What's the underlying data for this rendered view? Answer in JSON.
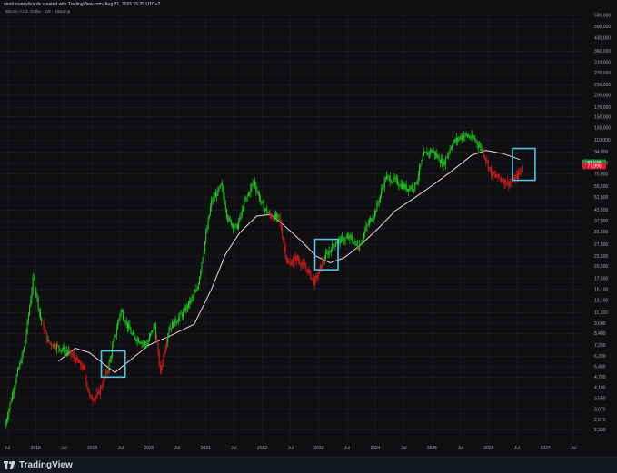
{
  "header": {
    "watermark": "stockmoneylizards created with TradingView.com, Aug 31, 2026 15:25 UTC+2",
    "symbol_line": "Bitcoin / U.S. Dollar · 1W · Bitstamp"
  },
  "footer": {
    "brand": "TradingView"
  },
  "colors": {
    "up": "#1fd31f",
    "down": "#e11b1b",
    "ma": "#f3d5de",
    "highlight_box": "#4fc3e8",
    "grid": "#1c2028",
    "axis_text": "#a3a6af",
    "price_tag_green": "#1f8f3a",
    "price_tag_red": "#d81e2e"
  },
  "chart_data": {
    "type": "candlestick",
    "scale": "log",
    "ylim": [
      2000,
      600000
    ],
    "y_ticks": [
      "580,000",
      "500,000",
      "430,000",
      "360,000",
      "310,000",
      "270,000",
      "230,000",
      "200,000",
      "170,000",
      "150,000",
      "130,000",
      "110,000",
      "94,000",
      "81,000",
      "70,000",
      "59,500",
      "51,500",
      "43,500",
      "37,500",
      "32,500",
      "27,500",
      "23,500",
      "20,500",
      "17,500",
      "15,100",
      "13,100",
      "11,100",
      "9,600",
      "8,400",
      "7,200",
      "6,200",
      "5,400",
      "4,700",
      "4,100",
      "3,550",
      "3,070",
      "2,670",
      "2,330"
    ],
    "x_ticks": [
      "Jul",
      "2018",
      "Jul",
      "2019",
      "Jul",
      "2020",
      "Jul",
      "2021",
      "Jul",
      "2022",
      "Jul",
      "2023",
      "Jul",
      "2024",
      "Jul",
      "2025",
      "Jul",
      "2026",
      "Jul",
      "2027",
      "Jul"
    ],
    "x_tick_dates": [
      2017.5,
      2018.0,
      2018.5,
      2019.0,
      2019.5,
      2020.0,
      2020.5,
      2021.0,
      2021.5,
      2022.0,
      2022.5,
      2023.0,
      2023.5,
      2024.0,
      2024.5,
      2025.0,
      2025.5,
      2026.0,
      2026.5,
      2027.0,
      2027.5
    ],
    "price_path": [
      {
        "date": 2017.45,
        "price": 2400
      },
      {
        "date": 2017.62,
        "price": 4200
      },
      {
        "date": 2017.8,
        "price": 7000
      },
      {
        "date": 2017.96,
        "price": 18000
      },
      {
        "date": 2018.08,
        "price": 10500
      },
      {
        "date": 2018.22,
        "price": 7500
      },
      {
        "date": 2018.4,
        "price": 7000
      },
      {
        "date": 2018.62,
        "price": 6400
      },
      {
        "date": 2018.85,
        "price": 5200
      },
      {
        "date": 2018.96,
        "price": 3500
      },
      {
        "date": 2019.1,
        "price": 3700
      },
      {
        "date": 2019.28,
        "price": 5300
      },
      {
        "date": 2019.5,
        "price": 11500
      },
      {
        "date": 2019.7,
        "price": 8200
      },
      {
        "date": 2019.96,
        "price": 7200
      },
      {
        "date": 2020.1,
        "price": 9500
      },
      {
        "date": 2020.2,
        "price": 5000
      },
      {
        "date": 2020.35,
        "price": 9000
      },
      {
        "date": 2020.6,
        "price": 11000
      },
      {
        "date": 2020.85,
        "price": 15000
      },
      {
        "date": 2021.0,
        "price": 30000
      },
      {
        "date": 2021.1,
        "price": 48000
      },
      {
        "date": 2021.28,
        "price": 60000
      },
      {
        "date": 2021.4,
        "price": 38000
      },
      {
        "date": 2021.55,
        "price": 34000
      },
      {
        "date": 2021.68,
        "price": 47000
      },
      {
        "date": 2021.85,
        "price": 64000
      },
      {
        "date": 2022.0,
        "price": 46000
      },
      {
        "date": 2022.15,
        "price": 40000
      },
      {
        "date": 2022.3,
        "price": 39000
      },
      {
        "date": 2022.45,
        "price": 21000
      },
      {
        "date": 2022.6,
        "price": 23000
      },
      {
        "date": 2022.8,
        "price": 19500
      },
      {
        "date": 2022.92,
        "price": 16500
      },
      {
        "date": 2023.1,
        "price": 23000
      },
      {
        "date": 2023.3,
        "price": 28500
      },
      {
        "date": 2023.55,
        "price": 30000
      },
      {
        "date": 2023.7,
        "price": 26500
      },
      {
        "date": 2023.85,
        "price": 35000
      },
      {
        "date": 2024.0,
        "price": 43000
      },
      {
        "date": 2024.18,
        "price": 67000
      },
      {
        "date": 2024.35,
        "price": 64000
      },
      {
        "date": 2024.55,
        "price": 58000
      },
      {
        "date": 2024.7,
        "price": 60000
      },
      {
        "date": 2024.85,
        "price": 90000
      },
      {
        "date": 2025.0,
        "price": 96000
      },
      {
        "date": 2025.2,
        "price": 80000
      },
      {
        "date": 2025.35,
        "price": 105000
      },
      {
        "date": 2025.55,
        "price": 118000
      },
      {
        "date": 2025.75,
        "price": 112000
      },
      {
        "date": 2025.9,
        "price": 95000
      },
      {
        "date": 2026.05,
        "price": 70000
      },
      {
        "date": 2026.2,
        "price": 66000
      },
      {
        "date": 2026.35,
        "price": 62000
      },
      {
        "date": 2026.5,
        "price": 68000
      },
      {
        "date": 2026.62,
        "price": 78000
      }
    ],
    "moving_average": [
      {
        "date": 2018.4,
        "price": 5800
      },
      {
        "date": 2018.7,
        "price": 6900
      },
      {
        "date": 2018.95,
        "price": 6500
      },
      {
        "date": 2019.2,
        "price": 5600
      },
      {
        "date": 2019.4,
        "price": 5000
      },
      {
        "date": 2019.7,
        "price": 6000
      },
      {
        "date": 2020.0,
        "price": 7200
      },
      {
        "date": 2020.4,
        "price": 8200
      },
      {
        "date": 2020.8,
        "price": 9500
      },
      {
        "date": 2021.1,
        "price": 15000
      },
      {
        "date": 2021.35,
        "price": 24000
      },
      {
        "date": 2021.6,
        "price": 32000
      },
      {
        "date": 2021.9,
        "price": 40000
      },
      {
        "date": 2022.15,
        "price": 41000
      },
      {
        "date": 2022.4,
        "price": 35000
      },
      {
        "date": 2022.7,
        "price": 28500
      },
      {
        "date": 2022.95,
        "price": 23500
      },
      {
        "date": 2023.2,
        "price": 21500
      },
      {
        "date": 2023.45,
        "price": 23000
      },
      {
        "date": 2023.75,
        "price": 27500
      },
      {
        "date": 2024.05,
        "price": 34000
      },
      {
        "date": 2024.35,
        "price": 43000
      },
      {
        "date": 2024.65,
        "price": 50000
      },
      {
        "date": 2025.0,
        "price": 60000
      },
      {
        "date": 2025.35,
        "price": 73000
      },
      {
        "date": 2025.7,
        "price": 90000
      },
      {
        "date": 2025.95,
        "price": 96000
      },
      {
        "date": 2026.25,
        "price": 92000
      },
      {
        "date": 2026.55,
        "price": 85000
      }
    ],
    "highlight_boxes": [
      {
        "x0": 2019.16,
        "x1": 2019.58,
        "y_low": 4700,
        "y_high": 6650
      },
      {
        "x0": 2022.93,
        "x1": 2023.34,
        "y_low": 19600,
        "y_high": 29400
      },
      {
        "x0": 2026.42,
        "x1": 2026.82,
        "y_low": 64500,
        "y_high": 98500
      }
    ],
    "price_tags": [
      {
        "label": "81,645",
        "price": 81645,
        "color": "#1f8f3a"
      },
      {
        "label": "77,996",
        "price": 77996,
        "color": "#d81e2e"
      }
    ]
  }
}
